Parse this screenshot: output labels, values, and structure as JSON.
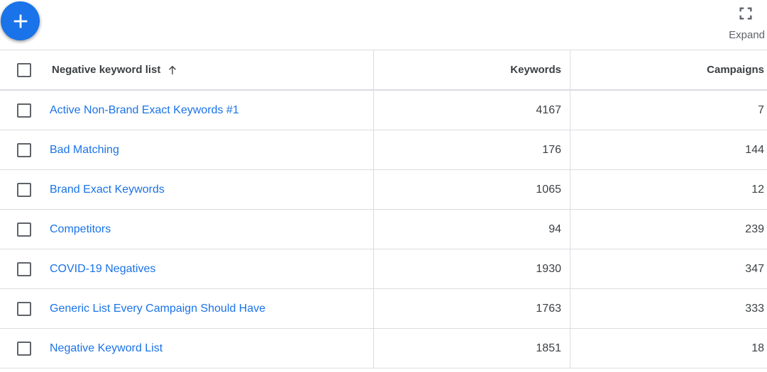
{
  "toolbar": {
    "add_icon": "plus-icon",
    "expand_icon": "fullscreen-icon",
    "expand_label": "Expand"
  },
  "colors": {
    "accent": "#1a73e8",
    "text": "#3c4043",
    "border": "#dadce0"
  },
  "table": {
    "columns": {
      "name": "Negative keyword list",
      "keywords": "Keywords",
      "campaigns": "Campaigns"
    },
    "sort": {
      "column": "name",
      "direction": "ascending",
      "icon": "arrow-up-icon"
    },
    "rows": [
      {
        "name": "Active Non-Brand Exact Keywords #1",
        "keywords": "4167",
        "campaigns": "7"
      },
      {
        "name": "Bad Matching",
        "keywords": "176",
        "campaigns": "144"
      },
      {
        "name": "Brand Exact Keywords",
        "keywords": "1065",
        "campaigns": "12"
      },
      {
        "name": "Competitors",
        "keywords": "94",
        "campaigns": "239"
      },
      {
        "name": "COVID-19 Negatives",
        "keywords": "1930",
        "campaigns": "347"
      },
      {
        "name": "Generic List Every Campaign Should Have",
        "keywords": "1763",
        "campaigns": "333"
      },
      {
        "name": "Negative Keyword List",
        "keywords": "1851",
        "campaigns": "18"
      }
    ]
  }
}
